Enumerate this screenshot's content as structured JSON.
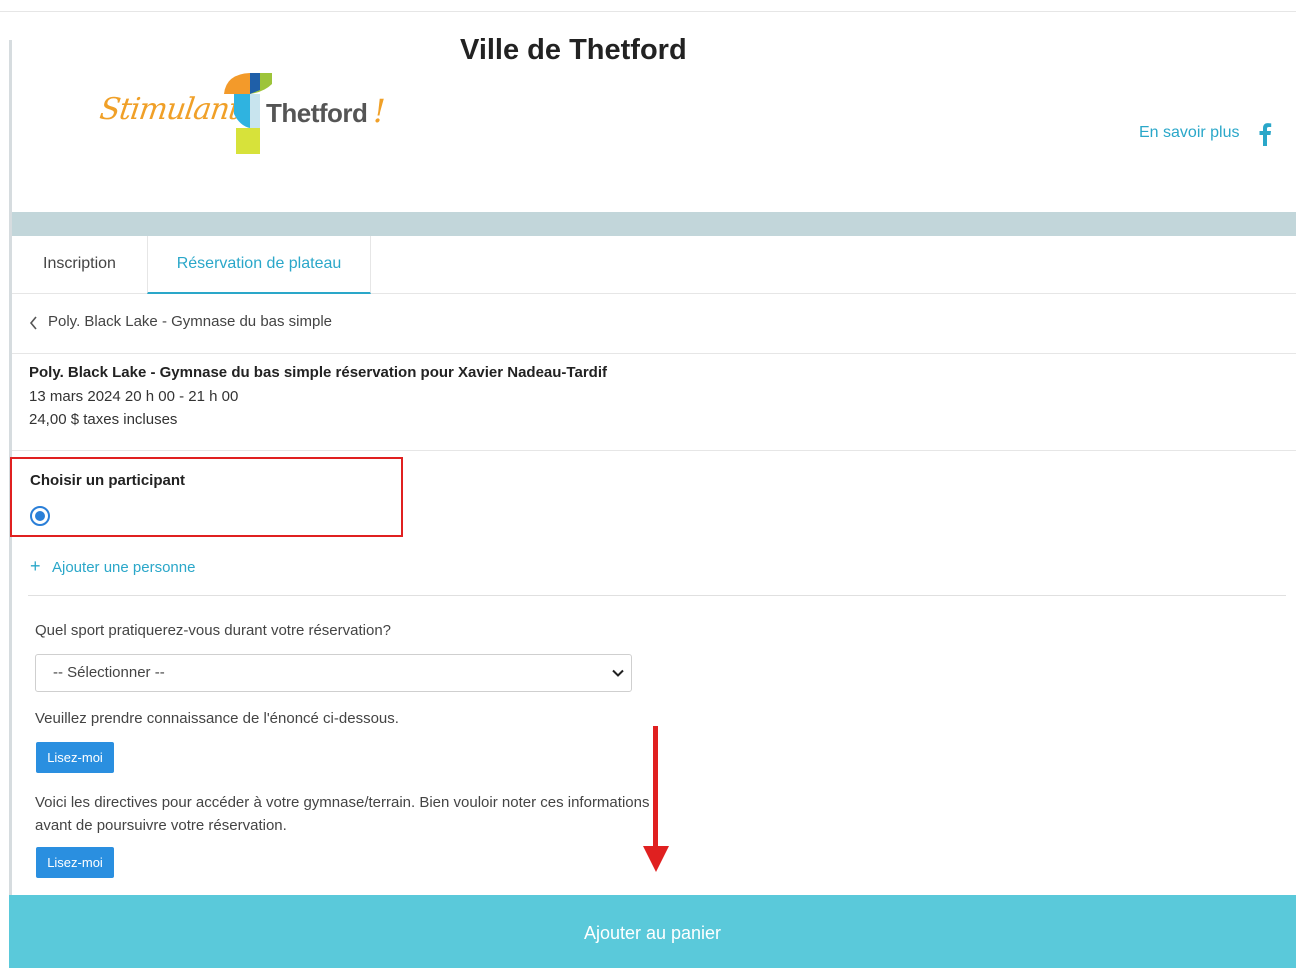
{
  "header": {
    "city_title": "Ville de Thetford",
    "logo": {
      "script_text": "Stimulante",
      "wordmark": "Thetford",
      "exclamation": "!"
    },
    "learn_more": "En savoir plus",
    "social_icon": "facebook-icon"
  },
  "tabs": [
    {
      "label": "Inscription",
      "active": false
    },
    {
      "label": "Réservation de plateau",
      "active": true
    }
  ],
  "breadcrumb": {
    "icon": "chevron-left-icon",
    "label": "Poly. Black Lake - Gymnase du bas simple"
  },
  "booking": {
    "title": "Poly. Black Lake - Gymnase du bas simple réservation pour Xavier Nadeau-Tardif",
    "date_time": "13 mars 2024  20 h 00 - 21 h 00",
    "price": "24,00 $ taxes incluses"
  },
  "participant": {
    "label": "Choisir un participant",
    "radio_selected": true,
    "add_person": "Ajouter une personne"
  },
  "form": {
    "sport_question": "Quel sport pratiquerez-vous durant votre réservation?",
    "sport_select_value": "-- Sélectionner --",
    "notice_1": "Veuillez prendre connaissance de l'énoncé ci-dessous.",
    "read_me_1": "Lisez-moi",
    "notice_2": "Voici les directives pour accéder à votre gymnase/terrain. Bien vouloir noter ces informations avant de poursuivre votre réservation.",
    "read_me_2": "Lisez-moi"
  },
  "cart": {
    "label": "Ajouter au panier"
  },
  "colors": {
    "accent": "#2aa7c9",
    "button_blue": "#2a8fe0",
    "cart_bg": "#5ac9da",
    "band": "#c2d6da",
    "annotation_red": "#e02020"
  }
}
